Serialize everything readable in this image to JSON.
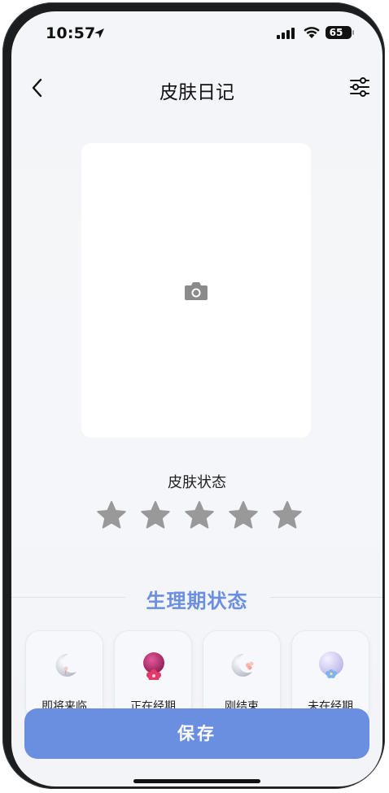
{
  "status_bar": {
    "time": "10:57",
    "battery": "65"
  },
  "nav": {
    "title": "皮肤日记",
    "back_icon": "chevron-left-icon",
    "filter_icon": "sliders-icon"
  },
  "photo": {
    "icon": "camera-icon"
  },
  "skin": {
    "label": "皮肤状态",
    "rating": 0,
    "max": 5
  },
  "period": {
    "title": "生理期状态",
    "options": [
      {
        "label": "即将来临",
        "icon": "moon-icon"
      },
      {
        "label": "正在经期",
        "icon": "flower-icon"
      },
      {
        "label": "刚结束",
        "icon": "moon-flower-icon"
      },
      {
        "label": "未在经期",
        "icon": "bubble-flower-icon"
      }
    ]
  },
  "actions": {
    "save_label": "保存"
  },
  "colors": {
    "accent": "#6b8fe0",
    "star_empty": "#999999",
    "background": "#f4f5f8"
  }
}
